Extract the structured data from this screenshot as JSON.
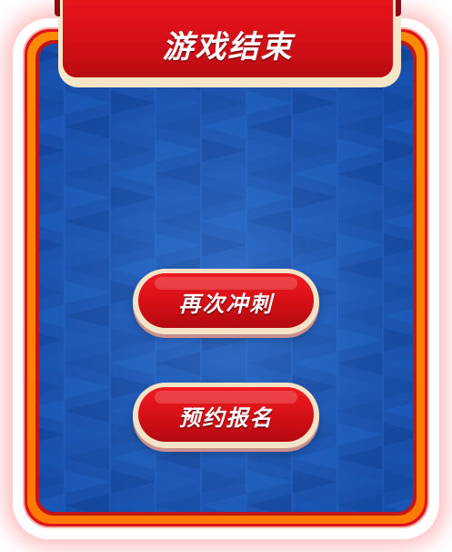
{
  "title": "游戏结束",
  "buttons": {
    "retry_label": "再次冲刺",
    "signup_label": "预约报名"
  },
  "colors": {
    "frame_red": "#e0121b",
    "frame_orange": "#ff8a00",
    "board_blue": "#1a55b4",
    "button_red": "#d40f16",
    "button_rim": "#f3e4c8",
    "text": "#ffffff"
  }
}
